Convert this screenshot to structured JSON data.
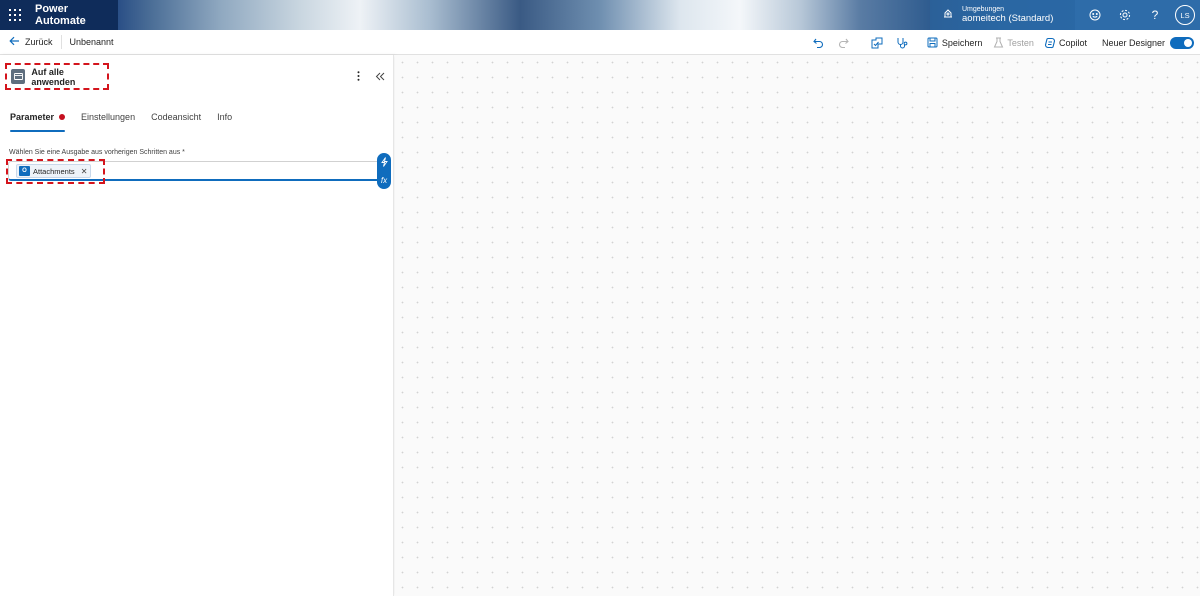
{
  "app": {
    "title": "Power Automate"
  },
  "environment": {
    "label": "Umgebungen",
    "name": "aomeitech (Standard)"
  },
  "user": {
    "initials": "LS"
  },
  "topbar_icons": [
    "waffle-icon",
    "environment-icon",
    "smiley-icon",
    "gear-icon",
    "help-icon"
  ],
  "commandbar": {
    "back_label": "Zurück",
    "flow_name": "Unbenannt",
    "save_label": "Speichern",
    "test_label": "Testen",
    "copilot_label": "Copilot",
    "new_designer_label": "Neuer Designer",
    "new_designer_on": true
  },
  "panel": {
    "title": "Auf alle anwenden",
    "tabs": [
      {
        "label": "Parameter",
        "active": true,
        "has_error": true
      },
      {
        "label": "Einstellungen",
        "active": false
      },
      {
        "label": "Codeansicht",
        "active": false
      },
      {
        "label": "Info",
        "active": false
      }
    ],
    "field": {
      "label": "Wählen Sie eine Ausgabe aus vorherigen Schritten aus *",
      "token": "Attachments"
    }
  },
  "colors": {
    "accent": "#0f6cbd",
    "error": "#c50f1f",
    "highlight": "#d4141c"
  }
}
